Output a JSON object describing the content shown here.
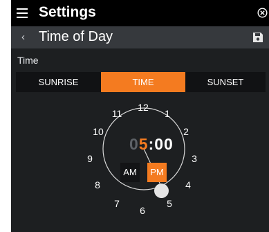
{
  "header": {
    "title": "Settings"
  },
  "subheader": {
    "title": "Time of Day"
  },
  "section": {
    "label": "Time"
  },
  "tabs": [
    {
      "label": "SUNRISE",
      "active": false
    },
    {
      "label": "TIME",
      "active": true
    },
    {
      "label": "SUNSET",
      "active": false
    }
  ],
  "clock": {
    "numbers": [
      "12",
      "1",
      "2",
      "3",
      "4",
      "5",
      "6",
      "7",
      "8",
      "9",
      "10",
      "11"
    ],
    "time_leading": "0",
    "time_hour": "5",
    "time_rest": ":00",
    "am_label": "AM",
    "pm_label": "PM",
    "selected_period": "PM"
  },
  "colors": {
    "accent": "#f47b20",
    "background": "#1d1f21",
    "topbar": "#000000",
    "subbar": "#36393d"
  },
  "icons": {
    "menu": "hamburger-menu-icon",
    "close": "close-circle-icon",
    "back": "chevron-left-icon",
    "save": "floppy-disk-icon"
  }
}
